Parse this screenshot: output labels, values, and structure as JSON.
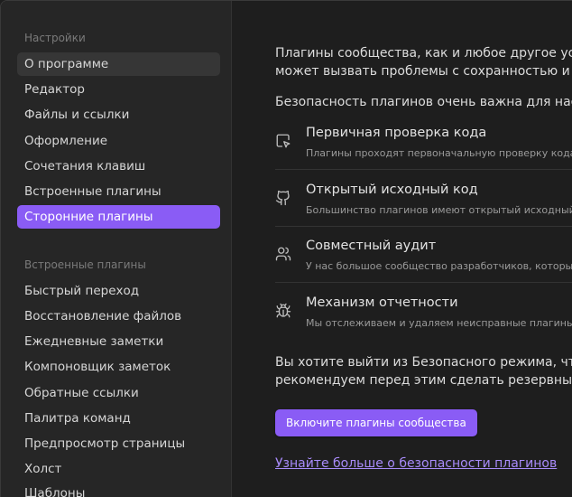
{
  "sidebar": {
    "settings_title": "Настройки",
    "settings_items": [
      {
        "label": "О программе",
        "state": "hover"
      },
      {
        "label": "Редактор",
        "state": ""
      },
      {
        "label": "Файлы и ссылки",
        "state": ""
      },
      {
        "label": "Оформление",
        "state": ""
      },
      {
        "label": "Сочетания клавиш",
        "state": ""
      },
      {
        "label": "Встроенные плагины",
        "state": ""
      },
      {
        "label": "Сторонние плагины",
        "state": "active"
      }
    ],
    "plugins_title": "Встроенные плагины",
    "plugin_items": [
      {
        "label": "Быстрый переход"
      },
      {
        "label": "Восстановление файлов"
      },
      {
        "label": "Ежедневные заметки"
      },
      {
        "label": "Компоновщик заметок"
      },
      {
        "label": "Обратные ссылки"
      },
      {
        "label": "Палитра команд"
      },
      {
        "label": "Предпросмотр страницы"
      },
      {
        "label": "Холст"
      },
      {
        "label": "Шаблоны"
      }
    ]
  },
  "main": {
    "intro_line1": "Плагины сообщества, как и любое другое устан",
    "intro_line2": "может вызвать проблемы с сохранностью и без",
    "importance": "Безопасность плагинов очень важна для нас. Во",
    "features": [
      {
        "icon": "pointer-check-icon",
        "title": "Первичная проверка кода",
        "desc": "Плагины проходят первоначальную проверку кода на"
      },
      {
        "icon": "github-icon",
        "title": "Открытый исходный код",
        "desc": "Большинство плагинов имеют открытый исходный ко"
      },
      {
        "icon": "users-icon",
        "title": "Совместный аудит",
        "desc": "У нас большое сообщество разработчиков, которые п"
      },
      {
        "icon": "bug-icon",
        "title": "Механизм отчетности",
        "desc": "Мы отслеживаем и удаляем неисправные плагины, ос"
      }
    ],
    "outro_line1": "Вы хотите выйти из Безопасного режима, чтобы",
    "outro_line2": "рекомендуем перед этим сделать резервные ко",
    "enable_button": "Включите плагины сообщества",
    "learn_more_link": "Узнайте больше о безопасности плагинов"
  },
  "colors": {
    "accent": "#8a5cf5",
    "link": "#a88bfa",
    "sidebar_bg": "#262626",
    "main_bg": "#1e1e1e"
  }
}
